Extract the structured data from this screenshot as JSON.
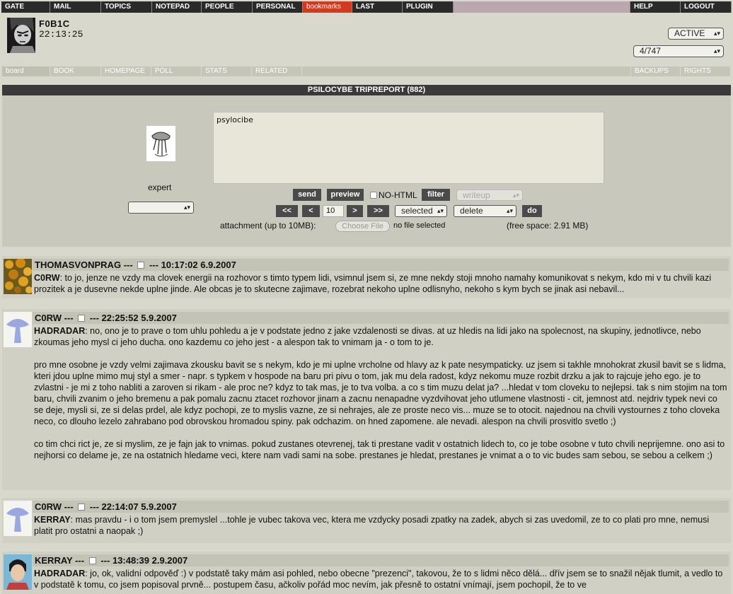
{
  "topmenu": [
    {
      "label": "GATE"
    },
    {
      "label": "MAIL"
    },
    {
      "label": "TOPICS"
    },
    {
      "label": "NOTEPAD"
    },
    {
      "label": "PEOPLE"
    },
    {
      "label": "PERSONAL"
    },
    {
      "label": "bookmarks"
    },
    {
      "label": "LAST"
    },
    {
      "label": "PLUGIN"
    },
    {
      "label": ""
    },
    {
      "label": "HELP"
    },
    {
      "label": "LOGOUT"
    }
  ],
  "header": {
    "username": "F0B1C",
    "time": "22:13:25",
    "status_select": "ACTIVE",
    "page_select": "4/747"
  },
  "submenu": [
    {
      "label": "board"
    },
    {
      "label": "BOOK"
    },
    {
      "label": "HOMEPAGE"
    },
    {
      "label": "POLL"
    },
    {
      "label": "STATS"
    },
    {
      "label": "RELATED"
    },
    {
      "label": ""
    },
    {
      "label": "BACKUPS"
    },
    {
      "label": "RIGHTS"
    }
  ],
  "board": {
    "title": "PSILOCYBE TRIPREPORT (882)",
    "owner_role": "expert",
    "textarea_value": "psylocibe",
    "send_label": "send",
    "preview_label": "preview",
    "nohtml_label": "NO-HTML",
    "filter_label": "filter",
    "writeup_select": "writeup",
    "first_label": "<<",
    "prev_label": "<",
    "count_value": "10",
    "next_label": ">",
    "last_label": ">>",
    "selected_select": "selected",
    "action_select": "delete",
    "do_label": "do",
    "attachment_label": "attachment (up to 10MB):",
    "choose_file_label": "Choose File",
    "no_file_label": "no file selected",
    "free_space": "(free space: 2.91 MB)"
  },
  "posts": [
    {
      "author": "THOMASVONPRAG",
      "sep1": "---",
      "sep2": "---",
      "datetime": "10:17:02 6.9.2007",
      "reply_to": "C0RW",
      "text": ": to jo, jenze ne vzdy ma clovek energii na rozhovor s timto typem lidi, vsimnul jsem si, ze mne nekdy stoji mnoho namahy komunikovat s nekym, kdo mi v tu chvili kazi prozitek a je dusevne nekde uplne jinde. Ale obcas je to skutecne zajimave, rozebrat nekoho uplne odlisnyho, nekoho s kym bych se jinak asi nebavil..."
    },
    {
      "author": "C0RW",
      "sep1": "---",
      "sep2": "---",
      "datetime": "22:25:52 5.9.2007",
      "reply_to": "HADRADAR",
      "text": ": no, ono je to prave o tom uhlu pohledu a je v podstate jedno z jake vzdalenosti se divas. at uz hledis na lidi jako na spolecnost, na skupiny, jednotlivce, nebo zkoumas jeho mysl ci jeho ducha. ono kazdemu co jeho jest - a alespon tak to vnimam ja - o tom to je.\n\npro mne osobne je vzdy velmi zajimava zkousku bavit se s nekym, kdo je mi uplne vrcholne od hlavy az k pate nesympaticky. uz jsem si takhle mnohokrat zkusil bavit se s lidma, kteri jdou uplne mimo muj styl a smer - napr. s typkem v hospode na baru pri pivu o tom, jak mu dela radost, kdyz nekomu muze rozbit drzku a jak to rajcuje jeho ego. je to zvlastni - je mi z toho nabliti a zaroven si rikam - ale proc ne? kdyz to tak mas, je to tva volba. a co s tim muzu delat ja? ...hledat v tom cloveku to nejlepsi. tak s nim stojim na tom baru, chvili zvanim o jeho bremenu a pak pomalu zacnu ztacet rozhovor jinam a zacnu nenapadne vyzdvihovat jeho utlumene vlastnosti - cit, jemnost atd. nejdriv typek nevi co se deje, mysli si, ze si delas prdel, ale kdyz pochopi, ze to myslis vazne, ze si nehrajes, ale ze proste neco vis... muze se to otocit. najednou na chvili vystournes z toho cloveka neco, co dlouho lezelo zahrabano pod obrovskou hromadou spiny. pak odchazim. on hned zapomene. ale nevadi. alespon na chvili prosvitlo svetlo ;)\n\nco tim chci rict je, ze si myslim, ze je fajn jak to vnimas. pokud zustanes otevrenej, tak ti prestane vadit v ostatnich lidech to, co je tobe osobne v tuto chvili neprijemne. ono asi to nejhorsi co delame je, ze na ostatnich hledame veci, ktere nam vadi sami na sobe. prestanes je hledat, prestanes je vnimat a o to vic budes sam sebou, se sebou a celkem ;)"
    },
    {
      "author": "C0RW",
      "sep1": "---",
      "sep2": "---",
      "datetime": "22:14:07 5.9.2007",
      "reply_to": "KERRAY",
      "text": ": mas pravdu - i o tom jsem premyslel ...tohle je vubec takova vec, ktera me vzdycky posadi zpatky na zadek, abych si zas uvedomil, ze to co plati pro mne, nemusi platit pro ostatni a naopak ;)"
    },
    {
      "author": "KERRAY",
      "sep1": "---",
      "sep2": "---",
      "datetime": "13:48:39 2.9.2007",
      "reply_to": "HADRADAR",
      "text": ": jo, ok, validní odpověď :) v podstatě taky mám asi pohled, nebo obecne \"prezenci\", takovou, že to s lidmi něco dělá... dřív jsem se to snažil nějak tlumit, a vedlo to v podstatě k tomu, co jsem popisoval prvně... postupem času, ačkoliv pořád moc nevím, jak přesně to ostatní vnímají, jsem pochopil, že to ve"
    }
  ]
}
